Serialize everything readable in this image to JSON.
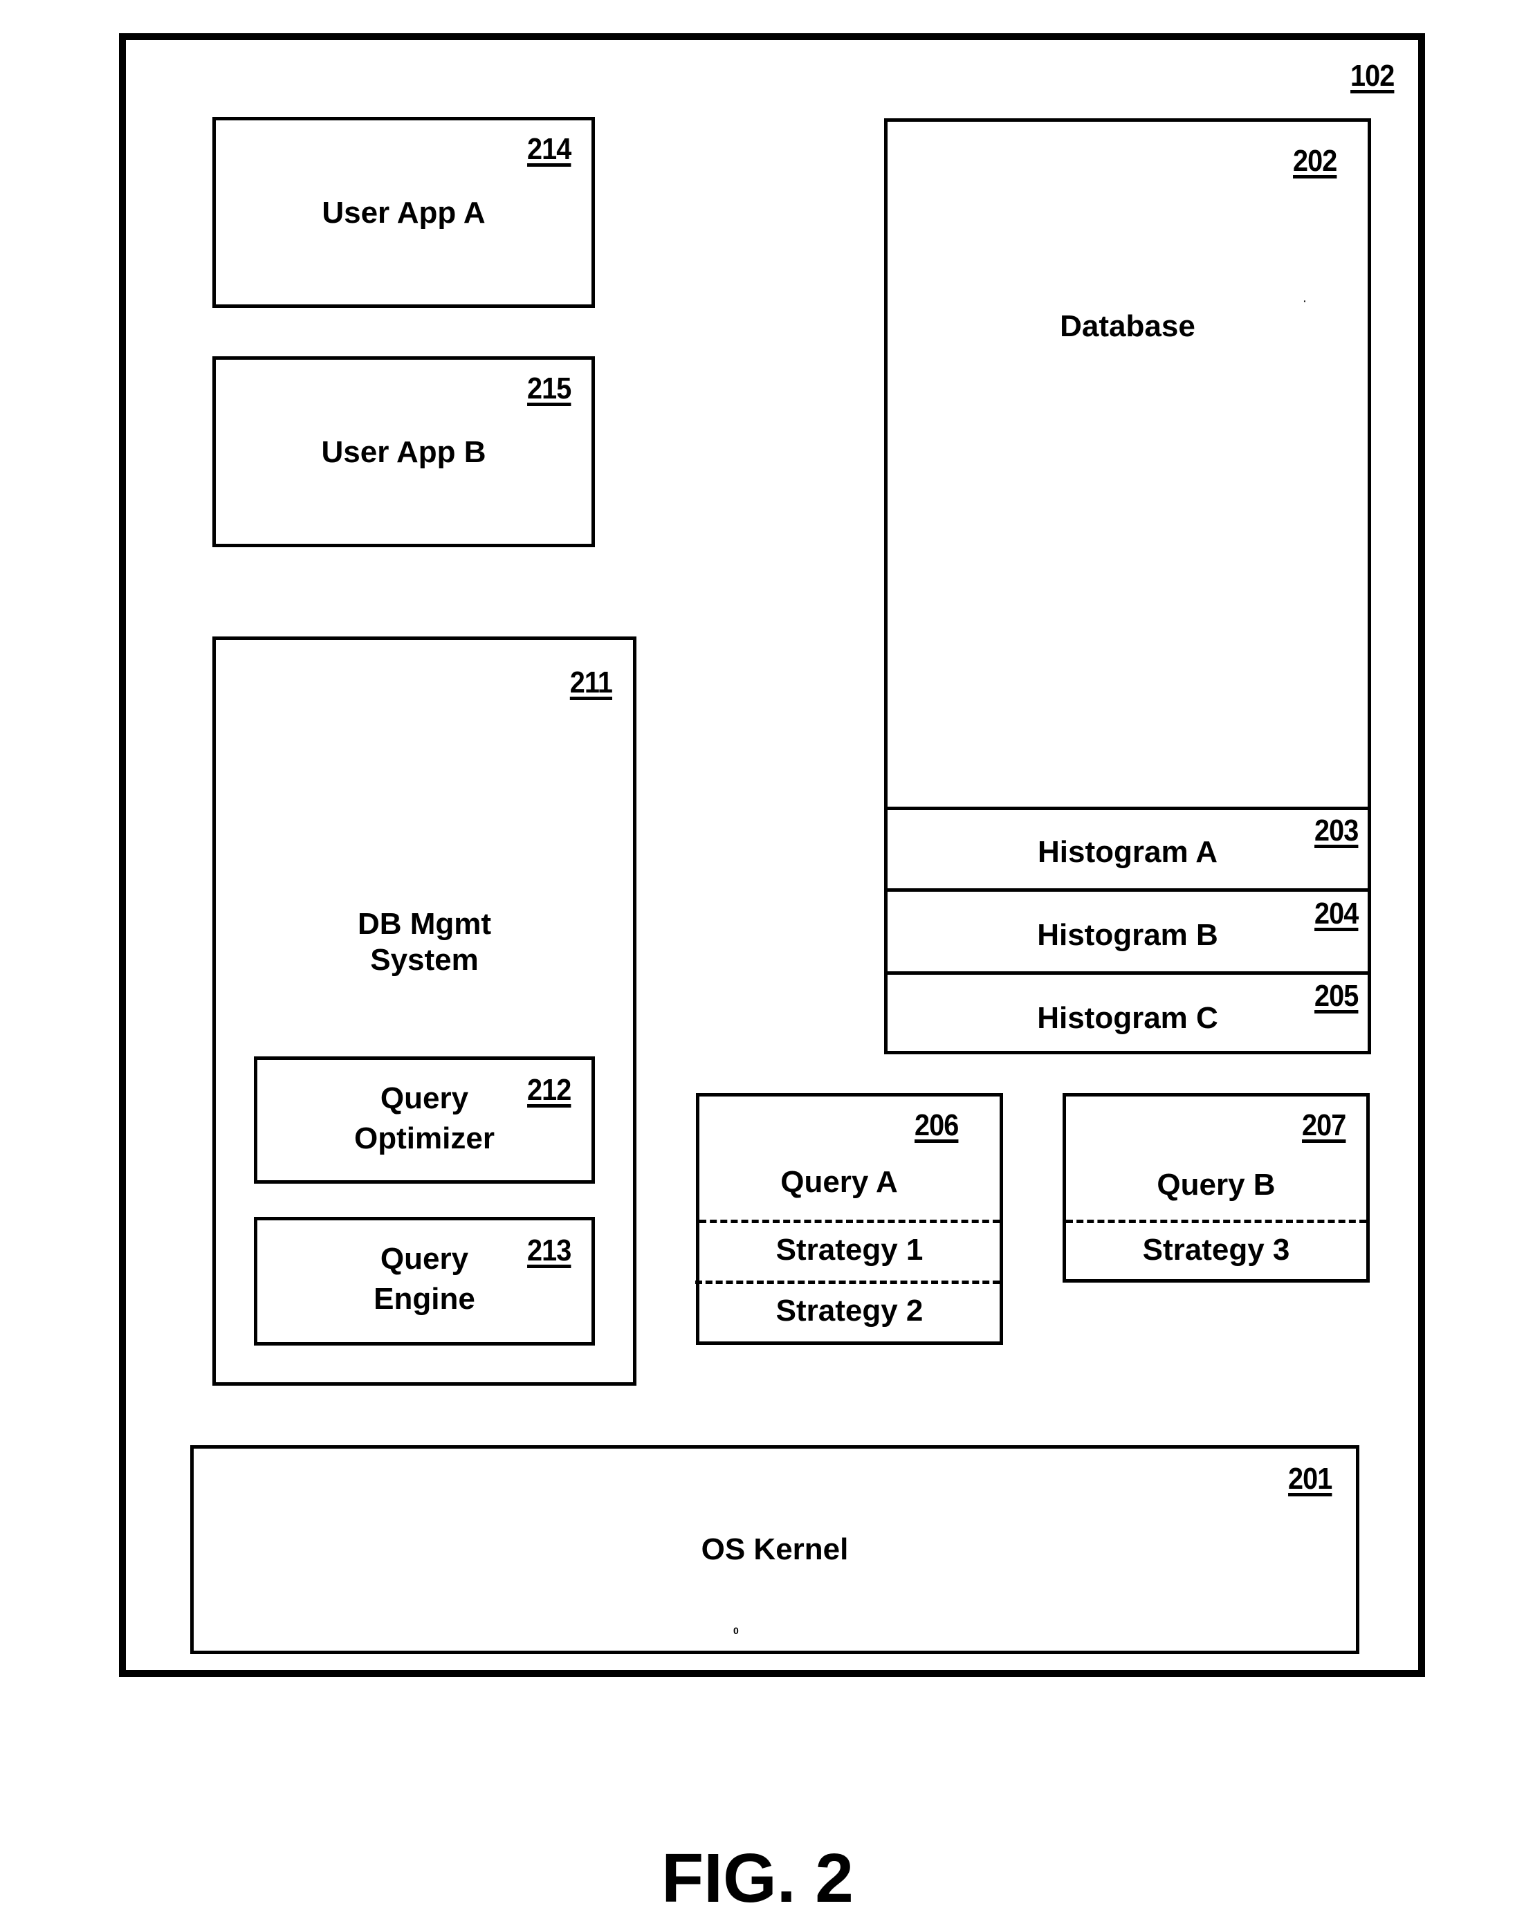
{
  "figure": {
    "caption": "FIG. 2",
    "system_ref": "102"
  },
  "components": {
    "user_app_a": {
      "ref": "214",
      "label": "User App A"
    },
    "user_app_b": {
      "ref": "215",
      "label": "User App B"
    },
    "dbms": {
      "ref": "211",
      "label_line1": "DB Mgmt",
      "label_line2": "System"
    },
    "query_optimizer": {
      "ref": "212",
      "label_line1": "Query",
      "label_line2": "Optimizer"
    },
    "query_engine": {
      "ref": "213",
      "label_line1": "Query",
      "label_line2": "Engine"
    },
    "database": {
      "ref": "202",
      "label": "Database"
    },
    "histograms": [
      {
        "ref": "203",
        "label": "Histogram A"
      },
      {
        "ref": "204",
        "label": "Histogram B"
      },
      {
        "ref": "205",
        "label": "Histogram C"
      }
    ],
    "query_a": {
      "ref": "206",
      "label": "Query A",
      "strategies": [
        "Strategy 1",
        "Strategy 2"
      ]
    },
    "query_b": {
      "ref": "207",
      "label": "Query B",
      "strategies": [
        "Strategy 3"
      ]
    },
    "os_kernel": {
      "ref": "201",
      "label": "OS Kernel"
    }
  }
}
